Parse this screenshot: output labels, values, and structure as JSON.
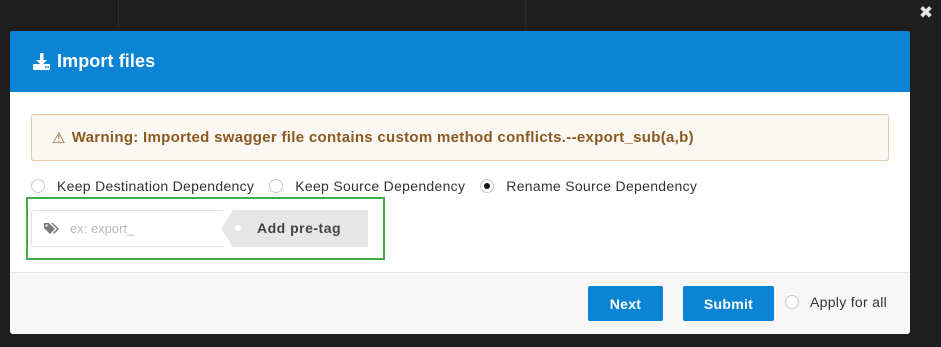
{
  "modal": {
    "title": "Import files",
    "title_icon": "download-icon",
    "header_color": "#0b84d3"
  },
  "warning": {
    "icon": "warning-triangle-icon",
    "text": "Warning: Imported swagger file contains custom method conflicts.--export_sub(a,b)"
  },
  "dependency_options": [
    {
      "label": "Keep Destination Dependency",
      "checked": false
    },
    {
      "label": "Keep Source Dependency",
      "checked": false
    },
    {
      "label": "Rename Source Dependency",
      "checked": true
    }
  ],
  "pretag": {
    "icon": "tags-icon",
    "placeholder": "ex: export_",
    "value": "",
    "button_label": "Add pre-tag",
    "highlight_color": "#3fae49"
  },
  "footer": {
    "next_label": "Next",
    "submit_label": "Submit",
    "apply_all_label": "Apply for all",
    "apply_all_checked": false
  },
  "close_icon": "close-icon"
}
